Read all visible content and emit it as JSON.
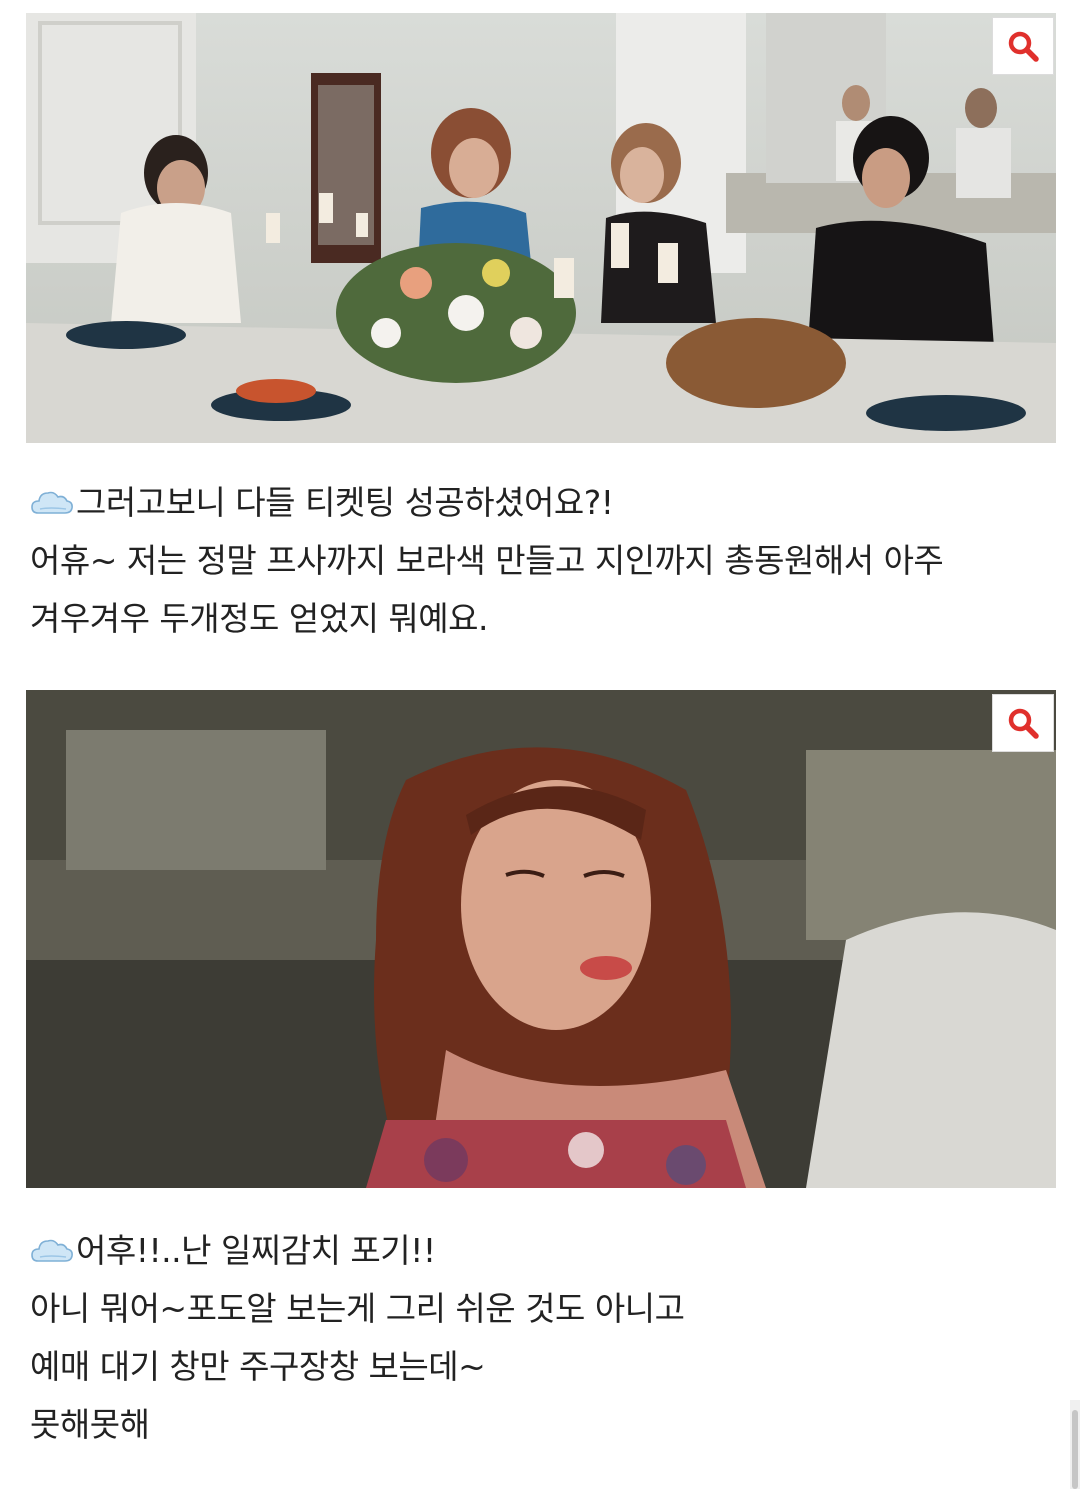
{
  "posts": [
    {
      "image": {
        "zoom_icon": "magnifier-icon"
      },
      "lines": [
        {
          "emoji": "cloud-emoji",
          "text": "그러고보니 다들 티켓팅 성공하셨어요?!"
        },
        {
          "text": "어휴~ 저는 정말 프사까지 보라색 만들고 지인까지 총동원해서 아주"
        },
        {
          "text": "겨우겨우 두개정도 얻었지 뭐예요."
        }
      ]
    },
    {
      "image": {
        "zoom_icon": "magnifier-icon"
      },
      "lines": [
        {
          "emoji": "cloud-emoji",
          "text": "어후!!..난 일찌감치 포기!!"
        },
        {
          "text": "아니 뭐어~포도알 보는게 그리 쉬운 것도 아니고"
        },
        {
          "text": "예매 대기 창만 주구장창 보는데~"
        },
        {
          "text": "못해못해"
        }
      ]
    }
  ],
  "colors": {
    "zoom_icon": "#e0302c",
    "text": "#222222"
  }
}
